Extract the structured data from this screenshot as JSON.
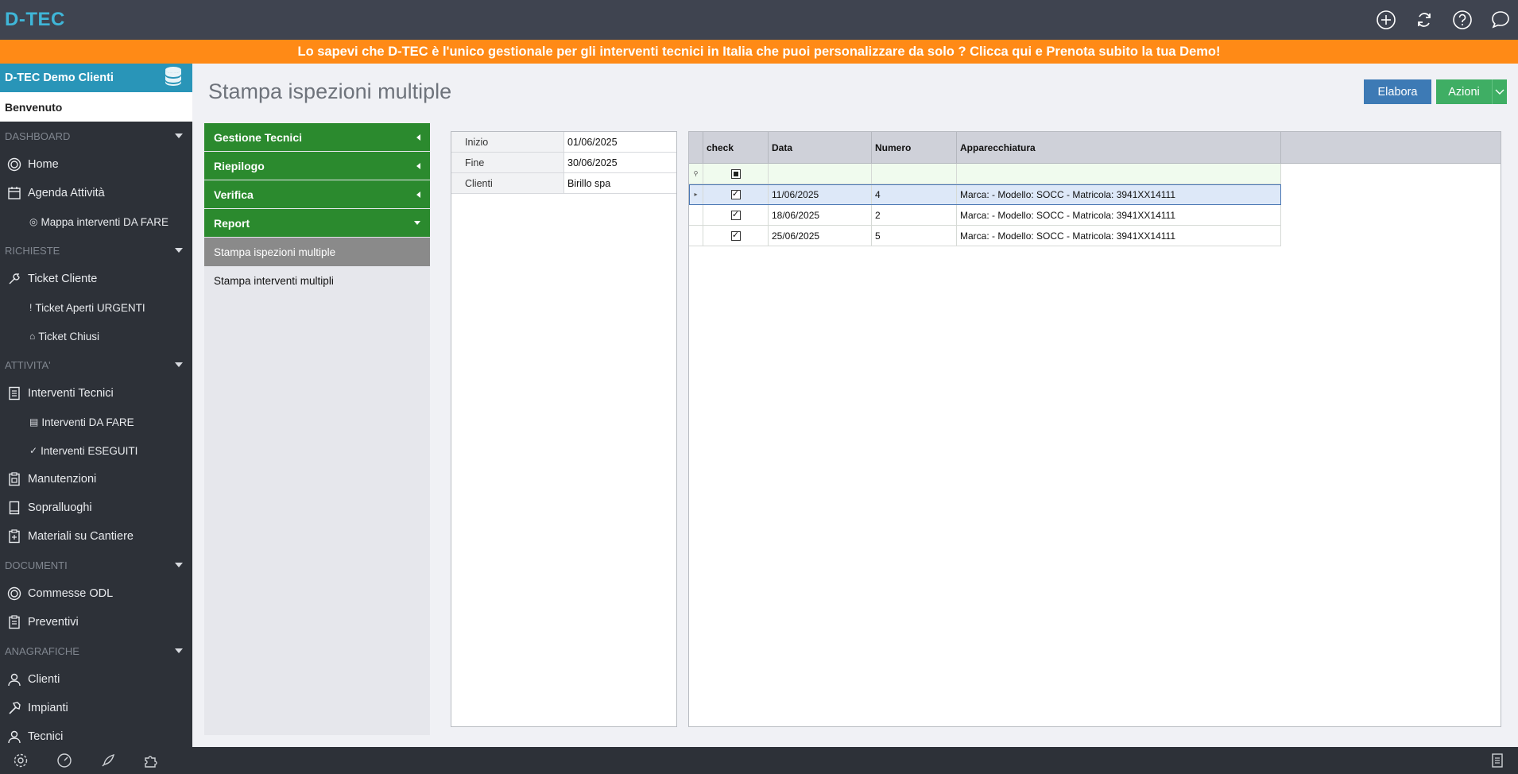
{
  "app": {
    "logo": "D-TEC",
    "banner": "Lo sapevi che D-TEC è l'unico gestionale per gli interventi tecnici in Italia che puoi personalizzare da solo ? Clicca qui e Prenota subito la tua Demo!",
    "top_icons": [
      "plus-circle-icon",
      "refresh-icon",
      "help-icon",
      "chat-icon"
    ]
  },
  "sidebar": {
    "account": "D-TEC Demo Clienti",
    "welcome": "Benvenuto",
    "sections": {
      "dashboard": "DASHBOARD",
      "richieste": "RICHIESTE",
      "attivita": "ATTIVITA'",
      "documenti": "DOCUMENTI",
      "anagrafiche": "ANAGRAFICHE"
    },
    "items": {
      "home": "Home",
      "agenda": "Agenda Attività",
      "mappa": "Mappa interventi DA FARE",
      "ticket_cliente": "Ticket Cliente",
      "ticket_urgenti": "Ticket Aperti URGENTI",
      "ticket_chiusi": "Ticket Chiusi",
      "interventi_tecnici": "Interventi Tecnici",
      "interventi_da_fare": "Interventi DA FARE",
      "interventi_eseguiti": "Interventi ESEGUITI",
      "manutenzioni": "Manutenzioni",
      "sopralluoghi": "Sopralluoghi",
      "materiali": "Materiali su Cantiere",
      "commesse": "Commesse ODL",
      "preventivi": "Preventivi",
      "clienti": "Clienti",
      "impianti": "Impianti",
      "tecnici": "Tecnici"
    }
  },
  "main": {
    "title": "Stampa ispezioni multiple",
    "elabora": "Elabora",
    "azioni": "Azioni"
  },
  "accordion": {
    "gestione_tecnici": "Gestione Tecnici",
    "riepilogo": "Riepilogo",
    "verifica": "Verifica",
    "report": "Report",
    "stampa_ispezioni": "Stampa ispezioni multiple",
    "stampa_interventi": "Stampa interventi multipli"
  },
  "filters": {
    "inizio_label": "Inizio",
    "inizio_value": "01/06/2025",
    "fine_label": "Fine",
    "fine_value": "30/06/2025",
    "clienti_label": "Clienti",
    "clienti_value": "Birillo spa"
  },
  "grid": {
    "columns": [
      "check",
      "Data",
      "Numero",
      "Apparecchiatura"
    ],
    "rows": [
      {
        "check": true,
        "data": "11/06/2025",
        "numero": "4",
        "apparecchiatura": "Marca:  - Modello: SOCC - Matricola: 3941XX14111"
      },
      {
        "check": true,
        "data": "18/06/2025",
        "numero": "2",
        "apparecchiatura": "Marca:  - Modello: SOCC - Matricola: 3941XX14111"
      },
      {
        "check": true,
        "data": "25/06/2025",
        "numero": "5",
        "apparecchiatura": "Marca:  - Modello: SOCC - Matricola: 3941XX14111"
      }
    ]
  },
  "colors": {
    "topbar": "#3f4450",
    "banner": "#ff8a16",
    "sidebar": "#2d3138",
    "account": "#2995b8",
    "accordion_head": "#2b8a2e",
    "elabora": "#3d7ab5",
    "azioni": "#3fae64"
  }
}
